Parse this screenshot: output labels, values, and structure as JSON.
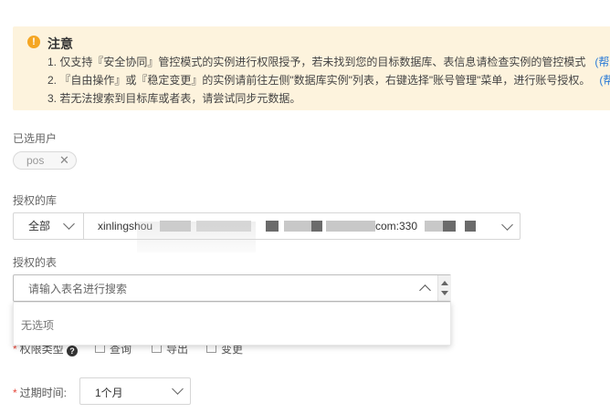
{
  "notice": {
    "icon": "warning-icon",
    "title": "注意",
    "lines": [
      "1. 仅支持『安全协同』管控模式的实例进行权限授予，若未找到您的目标数据库、表信息请检查实例的管控模式",
      "2. 『自由操作』或『稳定变更』的实例请前往左侧\"数据库实例\"列表，右键选择\"账号管理\"菜单，进行账号授权。",
      "3. 若无法搜索到目标库或者表，请尝试同步元数据。"
    ],
    "help_links": [
      "(帮助文",
      "(帮助文"
    ],
    "colors": {
      "background": "#fdf3dd",
      "icon": "#f5a623",
      "link": "#2b7bd6"
    }
  },
  "selected_users": {
    "label": "已选用户",
    "tags": [
      {
        "text": "pos",
        "close": "✕"
      }
    ]
  },
  "database": {
    "label": "授权的库",
    "scope": "全部",
    "value_prefix": "xinlingshou",
    "value_suffix": "com:330"
  },
  "table": {
    "label": "授权的表",
    "placeholder": "请输入表名进行搜索",
    "empty_text": "无选项"
  },
  "permission": {
    "label": "权限类型",
    "help_icon": "?",
    "options": [
      "查询",
      "导出",
      "变更"
    ]
  },
  "expiry": {
    "label": "过期时间:",
    "value": "1个月"
  },
  "required_mark": "*"
}
